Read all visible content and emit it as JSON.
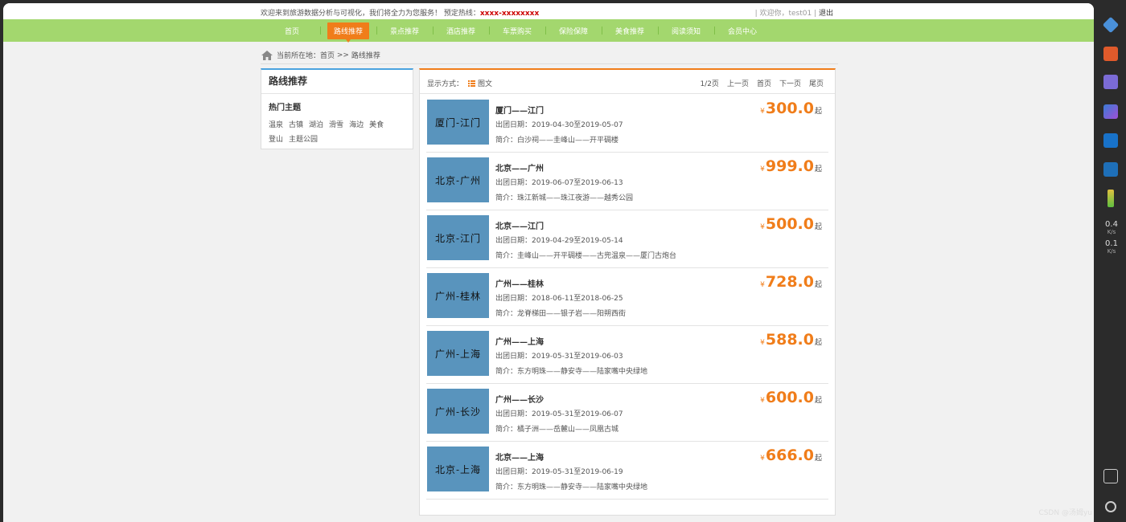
{
  "topbar": {
    "welcome": "欢迎来到旅游数据分析与可视化，我们将全力为您服务！ 预定热线：",
    "hotline": "xxxx-xxxxxxxx",
    "greeting": "| 欢迎你，",
    "username": "test01",
    "separator": " | ",
    "logout": "退出"
  },
  "nav": {
    "items": [
      "首页",
      "路线推荐",
      "景点推荐",
      "酒店推荐",
      "车票购买",
      "保险保障",
      "美食推荐",
      "阅读须知",
      "会员中心"
    ],
    "active_index": 1
  },
  "breadcrumb": {
    "prefix": "当前所在地：",
    "home": "首页",
    "sep": " >> ",
    "current": "路线推荐"
  },
  "sidebar": {
    "title": "路线推荐",
    "theme_title": "热门主题",
    "tags": [
      "温泉",
      "古镇",
      "湖泊",
      "滑雪",
      "海边",
      "美食",
      "登山",
      "主题公园"
    ]
  },
  "list_header": {
    "mode_label": "显示方式：",
    "mode_value": "图文",
    "page": "1/2页",
    "prev": "上一页",
    "first": "首页",
    "next": "下一页",
    "last": "尾页"
  },
  "routes": [
    {
      "thumb": "厦门-江门",
      "name": "厦门——江门",
      "date": "出团日期：2019-04-30至2019-05-07",
      "intro": "简介：白沙祠——圭峰山——开平碉楼",
      "price": "300.0"
    },
    {
      "thumb": "北京-广州",
      "name": "北京——广州",
      "date": "出团日期：2019-06-07至2019-06-13",
      "intro": "简介：珠江新城——珠江夜游——越秀公园",
      "price": "999.0"
    },
    {
      "thumb": "北京-江门",
      "name": "北京——江门",
      "date": "出团日期：2019-04-29至2019-05-14",
      "intro": "简介：圭峰山——开平碉楼——古兜温泉——厦门古炮台",
      "price": "500.0"
    },
    {
      "thumb": "广州-桂林",
      "name": "广州——桂林",
      "date": "出团日期：2018-06-11至2018-06-25",
      "intro": "简介：龙脊梯田——银子岩——阳朔西街",
      "price": "728.0"
    },
    {
      "thumb": "广州-上海",
      "name": "广州——上海",
      "date": "出团日期：2019-05-31至2019-06-03",
      "intro": "简介：东方明珠——静安寺——陆家嘴中央绿地",
      "price": "588.0"
    },
    {
      "thumb": "广州-长沙",
      "name": "广州——长沙",
      "date": "出团日期：2019-05-31至2019-06-07",
      "intro": "简介：橘子洲——岳麓山——凤凰古城",
      "price": "600.0"
    },
    {
      "thumb": "北京-上海",
      "name": "北京——上海",
      "date": "出团日期：2019-05-31至2019-06-19",
      "intro": "简介：东方明珠——静安寺——陆家嘴中央绿地",
      "price": "666.0"
    }
  ],
  "currency": "¥",
  "price_suffix": "起",
  "system": {
    "upload_speed": "0.4",
    "download_speed": "0.1",
    "speed_unit": "K/s",
    "watermark": "CSDN @汤姆yu"
  },
  "colors": {
    "nav_green": "#a3d76e",
    "accent_orange": "#f07d1a",
    "thumb_blue": "#5994bd",
    "sidebar_blue": "#4aa3df"
  }
}
